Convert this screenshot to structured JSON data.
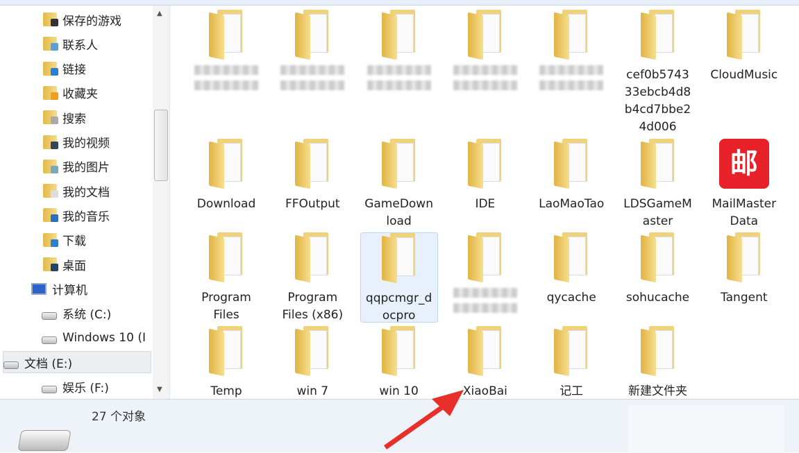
{
  "nav": {
    "items": [
      {
        "label": "保存的游戏",
        "icon": "saved-games-folder-icon",
        "color": "#333"
      },
      {
        "label": "联系人",
        "icon": "contacts-folder-icon",
        "color": "#5aa0d8"
      },
      {
        "label": "链接",
        "icon": "links-folder-icon",
        "color": "#2a7fd4"
      },
      {
        "label": "收藏夹",
        "icon": "favorites-folder-icon",
        "color": "#f0a020"
      },
      {
        "label": "搜索",
        "icon": "search-folder-icon",
        "color": "#aaa"
      },
      {
        "label": "我的视频",
        "icon": "videos-folder-icon",
        "color": "#345"
      },
      {
        "label": "我的图片",
        "icon": "pictures-folder-icon",
        "color": "#7ab"
      },
      {
        "label": "我的文档",
        "icon": "documents-folder-icon",
        "color": "#ddd"
      },
      {
        "label": "我的音乐",
        "icon": "music-folder-icon",
        "color": "#2a70c0"
      },
      {
        "label": "下载",
        "icon": "downloads-folder-icon",
        "color": "#2a80d0"
      },
      {
        "label": "桌面",
        "icon": "desktop-folder-icon",
        "color": "#246"
      },
      {
        "label": "计算机",
        "icon": "computer-icon",
        "type": "pc"
      },
      {
        "label": "系统 (C:)",
        "icon": "system-drive-icon",
        "type": "drive"
      },
      {
        "label": "Windows 10 (I",
        "icon": "drive-icon",
        "type": "drive"
      },
      {
        "label": "文档 (E:)",
        "icon": "drive-icon",
        "type": "drive",
        "selected": true
      },
      {
        "label": "娱乐 (F:)",
        "icon": "drive-icon",
        "type": "drive"
      }
    ]
  },
  "files": [
    {
      "label": "",
      "blurred": true
    },
    {
      "label": "",
      "blurred": true
    },
    {
      "label": "",
      "blurred": true
    },
    {
      "label": "",
      "blurred": true,
      "icon": "winrar-icon"
    },
    {
      "label": "",
      "blurred": true
    },
    {
      "label": "cef0b574333ebcb4d8b4cd7bbe24d006"
    },
    {
      "label": "CloudMusic",
      "dark": true
    },
    {
      "label": "Download"
    },
    {
      "label": "FFOutput"
    },
    {
      "label": "GameDownload"
    },
    {
      "label": "IDE"
    },
    {
      "label": "LaoMaoTao"
    },
    {
      "label": "LDSGameMaster"
    },
    {
      "label": "MailMasterData",
      "app": "邮"
    },
    {
      "label": "Program Files"
    },
    {
      "label": "Program Files (x86)"
    },
    {
      "label": "qqpcmgr_docpro",
      "selected": true
    },
    {
      "label": "",
      "blurred": true
    },
    {
      "label": "qycache"
    },
    {
      "label": "sohucache"
    },
    {
      "label": "Tangent"
    },
    {
      "label": "Temp"
    },
    {
      "label": "win 7"
    },
    {
      "label": "win 10"
    },
    {
      "label": "XiaoBai"
    },
    {
      "label": "记工"
    },
    {
      "label": "新建文件夹"
    }
  ],
  "status": {
    "count": "27 个对象"
  },
  "colors": {
    "arrow": "#e8302a",
    "folder": "#f0d27a"
  }
}
